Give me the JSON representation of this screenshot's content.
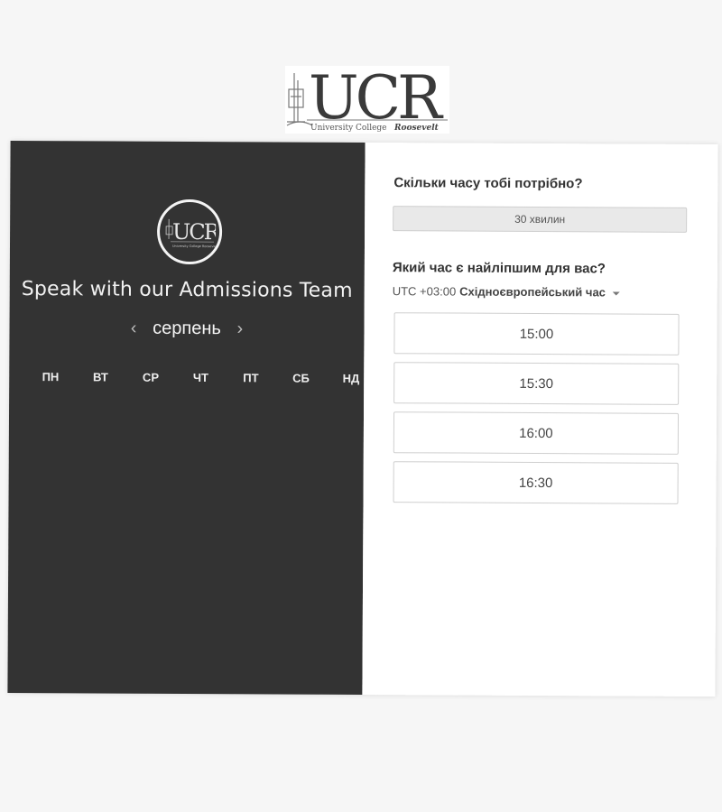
{
  "logo": {
    "letters": "UCR",
    "subtitle": "University College Roosevelt"
  },
  "left": {
    "title": "Speak with our Admissions Team",
    "month": "серпень",
    "prev_icon": "chevron-left-icon",
    "next_icon": "chevron-right-icon",
    "weekdays": [
      "ПН",
      "ВТ",
      "СР",
      "ЧТ",
      "ПТ",
      "СБ",
      "НД"
    ]
  },
  "right": {
    "duration_question": "Скільки часу тобі потрібно?",
    "duration_value": "30 хвилин",
    "time_question": "Який час є найліпшим для вас?",
    "timezone_offset": "UTC +03:00",
    "timezone_name": "Східноєвропейський час",
    "slots": [
      "15:00",
      "15:30",
      "16:00",
      "16:30"
    ]
  },
  "colors": {
    "left_panel": "#333333",
    "right_panel": "#ffffff",
    "page_bg": "#f6f6f6"
  }
}
